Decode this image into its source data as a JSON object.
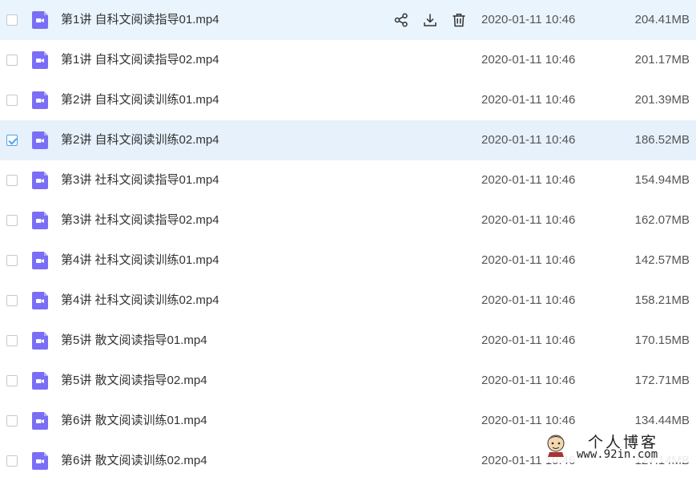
{
  "colors": {
    "file_icon": "#7b6ef6",
    "hover_row": "#eaf4fc",
    "selected_row": "#e6f1fb",
    "checkbox_check": "#4aa3ef"
  },
  "row_actions": {
    "share_icon": "share-icon",
    "download_icon": "download-icon",
    "delete_icon": "trash-icon"
  },
  "files": [
    {
      "name": "第1讲 自科文阅读指导01.mp4",
      "date": "2020-01-11 10:46",
      "size": "204.41MB",
      "checked": false,
      "hovered": true
    },
    {
      "name": "第1讲 自科文阅读指导02.mp4",
      "date": "2020-01-11 10:46",
      "size": "201.17MB",
      "checked": false,
      "hovered": false
    },
    {
      "name": "第2讲 自科文阅读训练01.mp4",
      "date": "2020-01-11 10:46",
      "size": "201.39MB",
      "checked": false,
      "hovered": false
    },
    {
      "name": "第2讲 自科文阅读训练02.mp4",
      "date": "2020-01-11 10:46",
      "size": "186.52MB",
      "checked": true,
      "hovered": false
    },
    {
      "name": "第3讲 社科文阅读指导01.mp4",
      "date": "2020-01-11 10:46",
      "size": "154.94MB",
      "checked": false,
      "hovered": false
    },
    {
      "name": "第3讲 社科文阅读指导02.mp4",
      "date": "2020-01-11 10:46",
      "size": "162.07MB",
      "checked": false,
      "hovered": false
    },
    {
      "name": "第4讲 社科文阅读训练01.mp4",
      "date": "2020-01-11 10:46",
      "size": "142.57MB",
      "checked": false,
      "hovered": false
    },
    {
      "name": "第4讲 社科文阅读训练02.mp4",
      "date": "2020-01-11 10:46",
      "size": "158.21MB",
      "checked": false,
      "hovered": false
    },
    {
      "name": "第5讲 散文阅读指导01.mp4",
      "date": "2020-01-11 10:46",
      "size": "170.15MB",
      "checked": false,
      "hovered": false
    },
    {
      "name": "第5讲 散文阅读指导02.mp4",
      "date": "2020-01-11 10:46",
      "size": "172.71MB",
      "checked": false,
      "hovered": false
    },
    {
      "name": "第6讲 散文阅读训练01.mp4",
      "date": "2020-01-11 10:46",
      "size": "134.44MB",
      "checked": false,
      "hovered": false
    },
    {
      "name": "第6讲 散文阅读训练02.mp4",
      "date": "2020-01-11 10:46",
      "size": "127.14MB",
      "checked": false,
      "hovered": false
    }
  ],
  "watermark": {
    "title": "个人博客",
    "url": "www.92in.com"
  }
}
